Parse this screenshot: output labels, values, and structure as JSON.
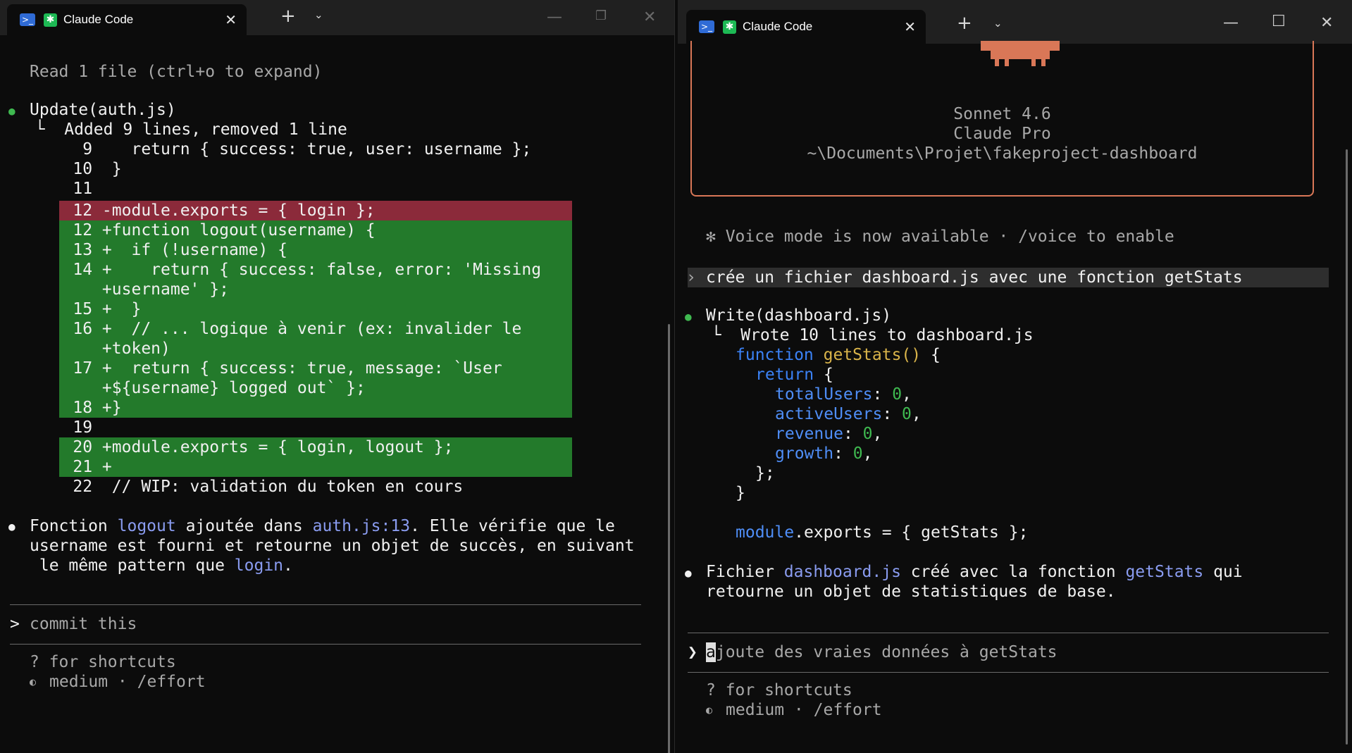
{
  "left": {
    "tab": {
      "title": "Claude Code",
      "close": "✕"
    },
    "new_tab": "+",
    "tab_menu": "⌄",
    "controls": {
      "min": "—",
      "max": "❐",
      "close": "✕"
    },
    "lines": {
      "read": "Read 1 file (ctrl+o to expand)",
      "update_bullet": "●",
      "update": "Update(auth.js)",
      "update_result": "  └  Added 9 lines, removed 1 line",
      "d9": "     9    return { success: true, user: username };",
      "d10": "    10  }",
      "d11": "    11",
      "d12del": "    12 -module.exports = { login };",
      "d12": "    12 +function logout(username) {",
      "d13": "    13 +  if (!username) {",
      "d14": "    14 +    return { success: false, error: 'Missing",
      "d14b": "       +username' };",
      "d15": "    15 +  }",
      "d16": "    16 +  // ... logique à venir (ex: invalider le",
      "d16b": "       +token)",
      "d17": "    17 +  return { success: true, message: `User",
      "d17b": "       +${username} logged out` };",
      "d18": "    18 +}",
      "d19": "    19",
      "d20": "    20 +module.exports = { login, logout };",
      "d21": "    21 +",
      "d22": "    22  // WIP: validation du token en cours"
    },
    "summary": {
      "bullet": "●",
      "p1": "Fonction ",
      "fn_name": "logout",
      "p2": " ajoutée dans ",
      "file_ref": "auth.js:13",
      "p3": ". Elle vérifie que le",
      "line2": "username est fourni et retourne un objet de succès, en suivant",
      "p4": " le même pattern que ",
      "login_ref": "login",
      "p5": "."
    },
    "prompt": {
      "symbol": ">",
      "text": "commit this"
    },
    "footer": {
      "shortcuts": "? for shortcuts",
      "effort_icon": "◐",
      "effort": "medium · /effort"
    }
  },
  "right": {
    "tab": {
      "title": "Claude Code",
      "close": "✕"
    },
    "new_tab": "+",
    "tab_menu": "⌄",
    "controls": {
      "min": "—",
      "max": "☐",
      "close": "✕"
    },
    "welcome": {
      "model": "Sonnet 4.6",
      "plan": "Claude Pro",
      "path": "~\\Documents\\Projet\\fakeproject-dashboard"
    },
    "voice_notice": "✻ Voice mode is now available · /voice to enable",
    "user_msg": {
      "symbol": "›",
      "text": "crée un fichier dashboard.js avec une fonction getStats"
    },
    "write": {
      "bullet": "●",
      "title": "Write(dashboard.js)",
      "result": "  └  Wrote 10 lines to dashboard.js"
    },
    "code": {
      "function_kw": "function",
      "fn_name": "getStats()",
      "open": " {",
      "return_kw": "return",
      "return_open": " {",
      "props": [
        {
          "name": "totalUsers",
          "value": "0"
        },
        {
          "name": "activeUsers",
          "value": "0"
        },
        {
          "name": "revenue",
          "value": "0"
        },
        {
          "name": "growth",
          "value": "0"
        }
      ],
      "close_obj": "};",
      "close_fn": "}",
      "module": "module",
      "exports": ".exports = { getStats };"
    },
    "summary": {
      "bullet": "●",
      "p1": "Fichier ",
      "file_ref": "dashboard.js",
      "p2": " créé avec la fonction ",
      "fn_ref": "getStats",
      "p3": " qui",
      "line2": "retourne un objet de statistiques de base."
    },
    "prompt": {
      "symbol": "❯",
      "cursor_char": "a",
      "placeholder": "joute des vraies données à getStats"
    },
    "footer": {
      "shortcuts": "? for shortcuts",
      "effort_icon": "◐",
      "effort": "medium · /effort"
    }
  }
}
